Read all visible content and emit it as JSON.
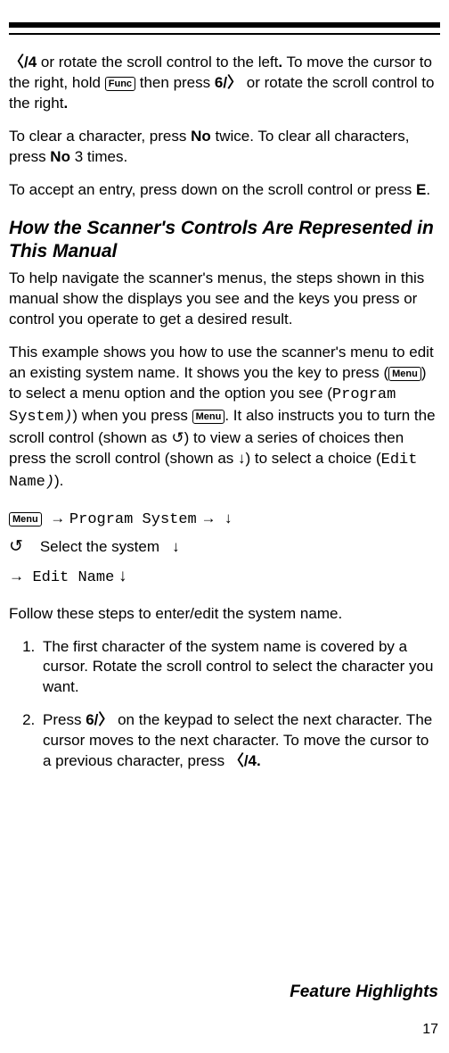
{
  "para1_a": "/4",
  "para1_b": " or rotate the scroll control to the left",
  "para1_c": ".",
  "para1_d": " To move the cursor to the right, hold ",
  "func_key": "Func",
  "para1_e": " then press ",
  "para1_f": "6/",
  "para1_g": " or rotate the scroll control to the right",
  "para1_h": ".",
  "para2_a": "To clear a character, press ",
  "para2_b": "No",
  "para2_c": " twice. To clear all characters, press ",
  "para2_d": "No",
  "para2_e": " 3 times.",
  "para3_a": "To accept an entry, press down on the scroll control or press ",
  "para3_b": "E",
  "para3_c": ".",
  "heading": "How the Scanner's Controls Are Represented in This Manual",
  "para4": "To help navigate the scanner's menus, the steps shown in this manual show the displays you see and the keys you press or control you operate to get a desired result.",
  "para5_a": "This example shows you how to use the scanner's menu to edit an existing system name. It shows you the key to press (",
  "menu_key": "Menu",
  "para5_b": ") to select a menu option and the option you see (",
  "program_system": "Program System",
  "para5_c": ") when you press ",
  "para5_d": ". It also instructs you to turn the scroll control (shown as ",
  "rotate_sym": "↺",
  "para5_e": ") to view a series of choices then press the scroll control (shown as ",
  "down_sym": "↓",
  "para5_f": ") to select a choice (",
  "edit_name": "Edit Name",
  "para5_g": ").",
  "ex_arrow": "→",
  "ex_select": "Select the system",
  "para6": "Follow these steps to enter/edit the system name.",
  "li1": "The first character of the system name is covered by a cursor. Rotate the scroll control to select the character you want.",
  "li2_a": "Press ",
  "li2_b": "6/",
  "li2_c": " on the keypad to select the next character. The cursor moves to the next character. To move the cursor to a previous character, press ",
  "li2_d": "/4.",
  "footer": "Feature Highlights",
  "pagenum": "17",
  "left_chev": "〈",
  "right_chev": "〉"
}
